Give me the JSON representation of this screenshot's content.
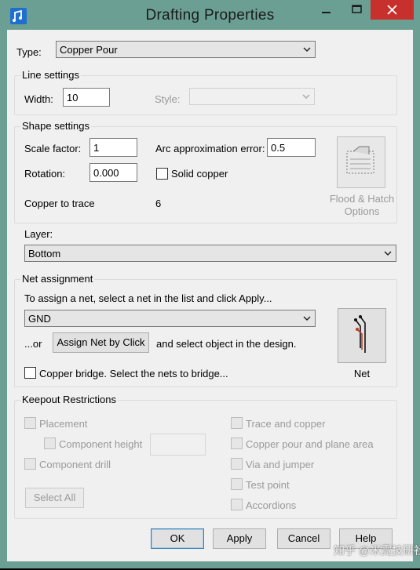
{
  "window": {
    "title": "Drafting Properties",
    "icon": "app-note-icon",
    "controls": [
      "minimize-icon",
      "maximize-icon",
      "close-icon"
    ]
  },
  "type": {
    "label": "Type:",
    "value": "Copper Pour"
  },
  "line_settings": {
    "title": "Line settings",
    "width_label": "Width:",
    "width_value": "10",
    "style_label": "Style:",
    "style_value": ""
  },
  "shape_settings": {
    "title": "Shape settings",
    "scale_label": "Scale factor:",
    "scale_value": "1",
    "arc_label": "Arc approximation error:",
    "arc_value": "0.5",
    "rotation_label": "Rotation:",
    "rotation_value": "0.000",
    "solid_label": "Solid copper",
    "solid_checked": false,
    "copper_trace_label": "Copper to trace",
    "copper_trace_value": "6",
    "flood_button_line1": "Flood & Hatch",
    "flood_button_line2": "Options"
  },
  "layer": {
    "label": "Layer:",
    "value": "Bottom"
  },
  "net_assignment": {
    "title": "Net assignment",
    "instruction": "To assign a net, select a net in the list and click Apply...",
    "net_value": "GND",
    "or_label": "...or",
    "assign_button": "Assign Net by Click",
    "after_assign": "and select object in the design.",
    "bridge_label": "Copper bridge. Select the nets to bridge...",
    "bridge_checked": false,
    "net_button_label": "Net"
  },
  "keepout": {
    "title": "Keepout Restrictions",
    "left_items": [
      "Placement",
      "Component height",
      "Component drill"
    ],
    "right_items": [
      "Trace and copper",
      "Copper pour and plane area",
      "Via and jumper",
      "Test point",
      "Accordions"
    ],
    "height_value": "",
    "select_all": "Select All"
  },
  "buttons": {
    "ok": "OK",
    "apply": "Apply",
    "cancel": "Cancel",
    "help": "Help"
  },
  "watermark": "知乎 @米霓技研社",
  "colors": {
    "titlebar": "#6c9f93",
    "close_button": "#c7302d",
    "dialog_bg": "#f0f0f0",
    "default_border": "#3c7fb1"
  }
}
